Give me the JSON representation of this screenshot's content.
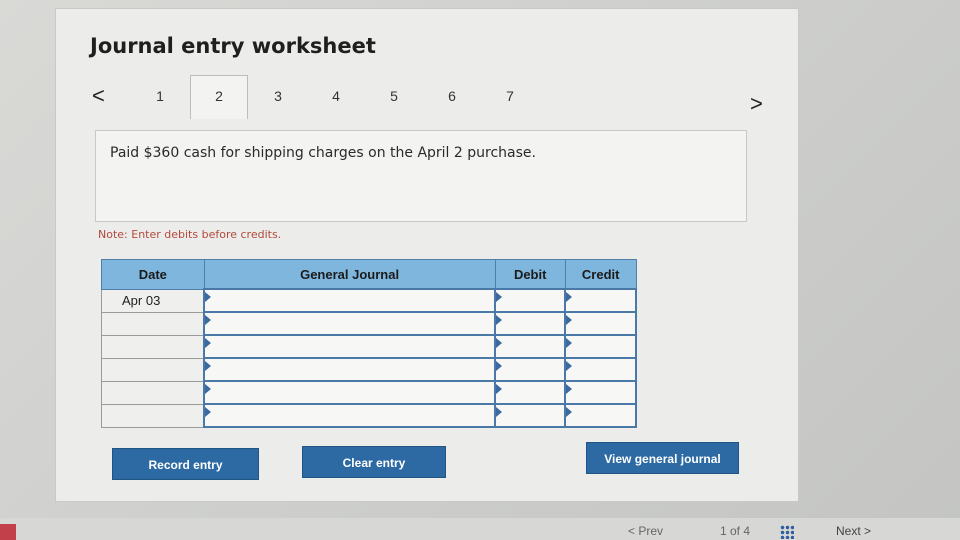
{
  "title": "Journal entry worksheet",
  "nav": {
    "prev_arrow": "<",
    "next_arrow": ">"
  },
  "tabs": [
    "1",
    "2",
    "3",
    "4",
    "5",
    "6",
    "7"
  ],
  "active_tab": "2",
  "description": "Paid $360 cash for shipping charges on the April 2 purchase.",
  "note": "Note: Enter debits before credits.",
  "table": {
    "headers": {
      "date": "Date",
      "account": "General Journal",
      "debit": "Debit",
      "credit": "Credit"
    },
    "rows": [
      {
        "date": "Apr 03",
        "account": "",
        "debit": "",
        "credit": ""
      },
      {
        "date": "",
        "account": "",
        "debit": "",
        "credit": ""
      },
      {
        "date": "",
        "account": "",
        "debit": "",
        "credit": ""
      },
      {
        "date": "",
        "account": "",
        "debit": "",
        "credit": ""
      },
      {
        "date": "",
        "account": "",
        "debit": "",
        "credit": ""
      },
      {
        "date": "",
        "account": "",
        "debit": "",
        "credit": ""
      }
    ]
  },
  "buttons": {
    "record": "Record entry",
    "clear": "Clear entry",
    "view": "View general journal"
  },
  "footer": {
    "prev": "< Prev",
    "page": "1 of 4",
    "next": "Next >"
  },
  "colors": {
    "header_blue": "#7fb6dd",
    "button_blue": "#2d6aa4",
    "note_red": "#b24a3c"
  }
}
